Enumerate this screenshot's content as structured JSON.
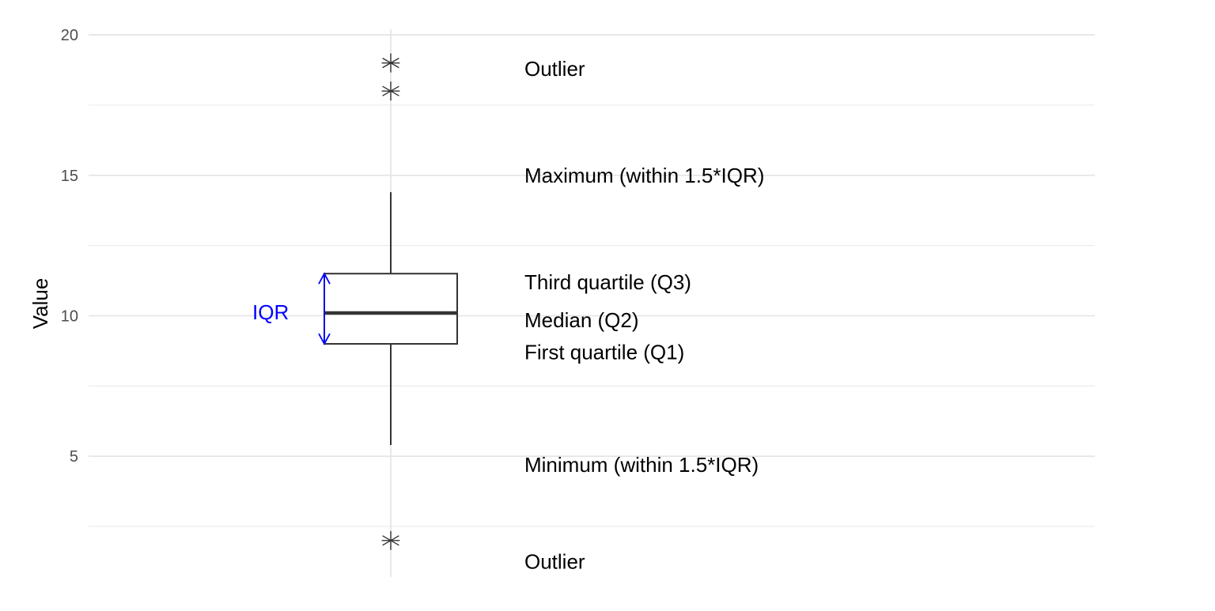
{
  "chart_data": {
    "type": "box",
    "title": "",
    "xlabel": "",
    "ylabel": "Value",
    "ylim": [
      0.7,
      20.2
    ],
    "yticks": [
      5,
      10,
      15,
      20
    ],
    "grid": true,
    "box": {
      "min": 5.4,
      "q1": 9.0,
      "median": 10.1,
      "q3": 11.5,
      "max": 14.4,
      "outliers": [
        19.0,
        18.0,
        2.0
      ]
    },
    "iqr_label": "IQR",
    "iqr_color": "#0000ff",
    "annotations": [
      {
        "label": "Outlier",
        "y": 18.8
      },
      {
        "label": "Maximum (within 1.5*IQR)",
        "y": 15.0
      },
      {
        "label": "Third quartile (Q3)",
        "y": 11.2
      },
      {
        "label": "Median (Q2)",
        "y": 9.85
      },
      {
        "label": "First quartile (Q1)",
        "y": 8.7
      },
      {
        "label": "Minimum (within 1.5*IQR)",
        "y": 4.7
      },
      {
        "label": "Outlier",
        "y": 1.25
      }
    ]
  }
}
